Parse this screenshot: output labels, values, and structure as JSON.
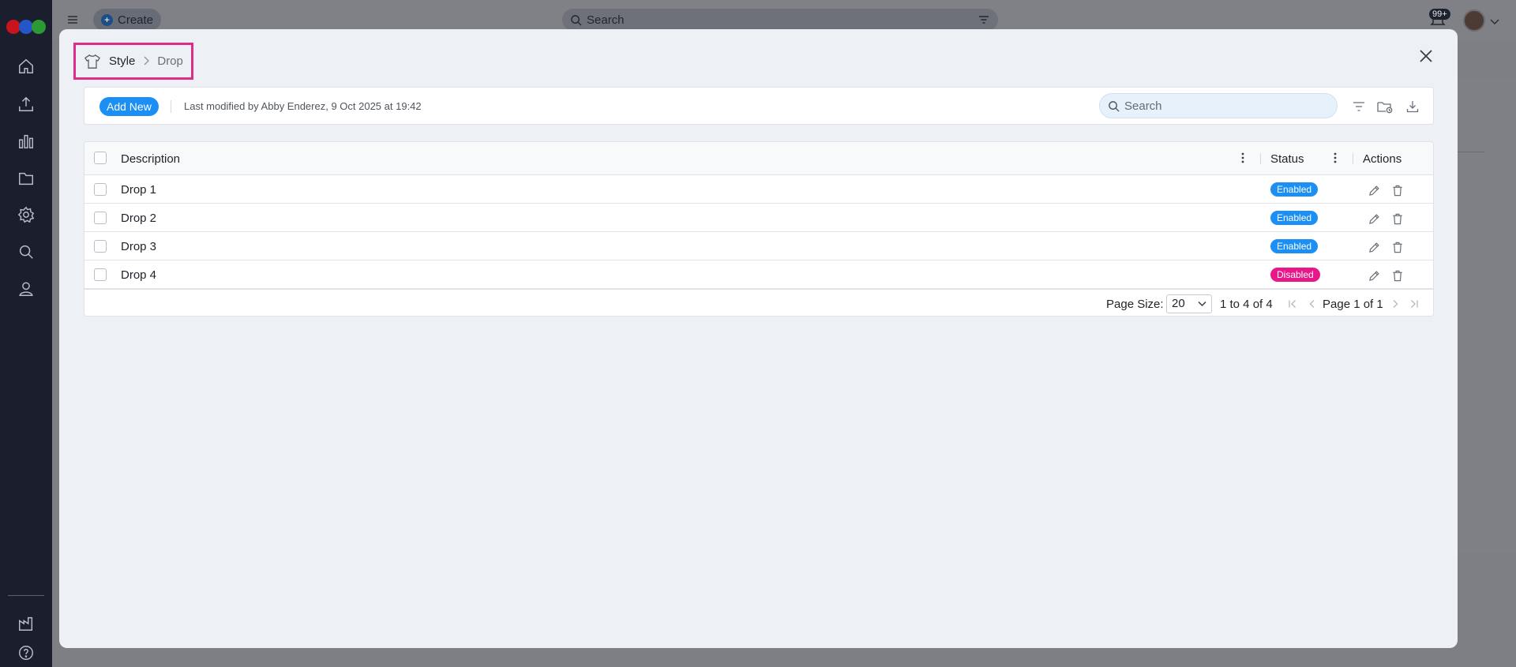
{
  "background_app": {
    "create_label": "Create",
    "search_placeholder": "Search",
    "notification_badge": "99+"
  },
  "sidebar": {
    "icons": [
      "home-icon",
      "upload-icon",
      "analytics-icon",
      "folder-icon",
      "settings-icon",
      "search-icon",
      "user-icon",
      "factory-icon",
      "help-icon"
    ]
  },
  "modal": {
    "breadcrumb": {
      "root": "Style",
      "current": "Drop"
    },
    "toolbar": {
      "add_label": "Add New",
      "last_modified": "Last modified by Abby Enderez, 9 Oct 2025 at 19:42",
      "search_placeholder": "Search"
    },
    "table": {
      "headers": {
        "description": "Description",
        "status": "Status",
        "actions": "Actions"
      },
      "rows": [
        {
          "description": "Drop 1",
          "status": "Enabled"
        },
        {
          "description": "Drop 2",
          "status": "Enabled"
        },
        {
          "description": "Drop 3",
          "status": "Enabled"
        },
        {
          "description": "Drop 4",
          "status": "Disabled"
        }
      ]
    },
    "pagination": {
      "page_size_label": "Page Size:",
      "page_size": "20",
      "range": "1 to 4 of 4",
      "page_info": "Page 1 of 1"
    }
  },
  "colors": {
    "accent": "#1b8ff3",
    "enabled": "#1b8ff3",
    "disabled": "#e8178a",
    "highlight": "#e02b88"
  }
}
